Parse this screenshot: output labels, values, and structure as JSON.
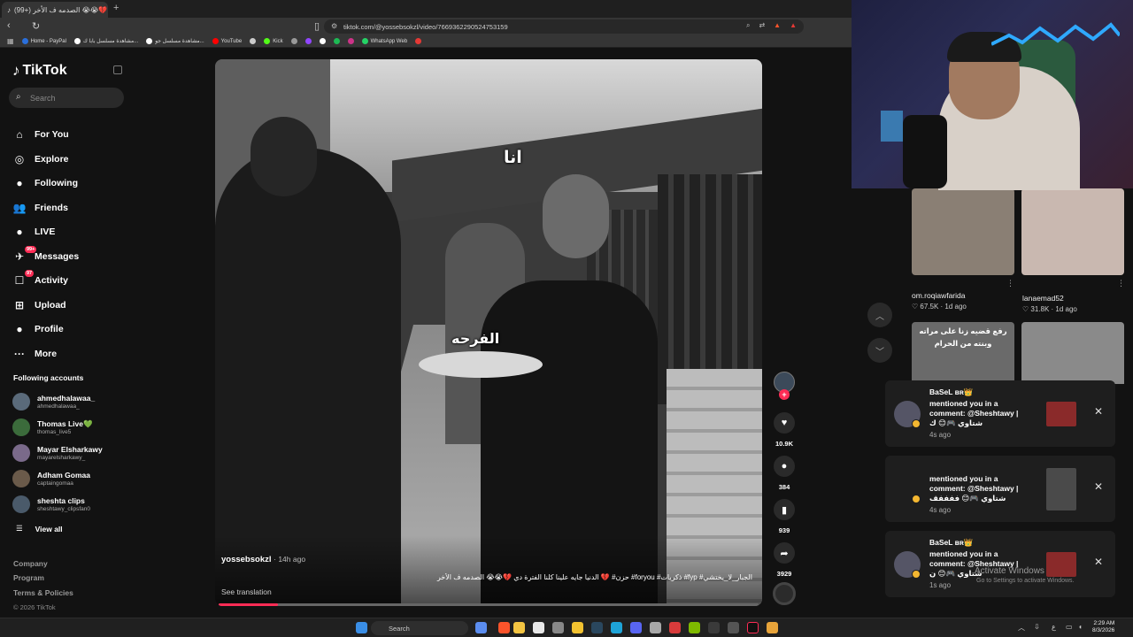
{
  "browser": {
    "tab_title": "(99+) الصدمه ف الأخر 😭😭💔",
    "tab_close": "✕",
    "new_tab": "+",
    "url": "tiktok.com/@yossebsokzl/video/7669362290524753159",
    "bookmarks": [
      {
        "label": "Home - PayPal",
        "color": "#2a6fdb"
      },
      {
        "label": "مشاهدة مسلسل بابا ك...",
        "color": "#ffffff"
      },
      {
        "label": "مشاهدة مسلسل جو...",
        "color": "#ffffff"
      },
      {
        "label": "YouTube",
        "color": "#ff0000"
      },
      {
        "label": "",
        "color": "#cccccc"
      },
      {
        "label": "Kick",
        "color": "#53fc18"
      },
      {
        "label": "",
        "color": "#999999"
      },
      {
        "label": "",
        "color": "#9146ff"
      },
      {
        "label": "",
        "color": "#ffffff"
      },
      {
        "label": "",
        "color": "#1db954"
      },
      {
        "label": "",
        "color": "#cc3388"
      },
      {
        "label": "WhatsApp Web",
        "color": "#25d366"
      },
      {
        "label": "",
        "color": "#e53935"
      }
    ]
  },
  "sidebar": {
    "logo": "TikTok",
    "search_placeholder": "Search",
    "nav": [
      {
        "label": "For You",
        "icon": "home-icon",
        "glyph": "⌂"
      },
      {
        "label": "Explore",
        "icon": "compass-icon",
        "glyph": "◎"
      },
      {
        "label": "Following",
        "icon": "following-icon",
        "glyph": "●"
      },
      {
        "label": "Friends",
        "icon": "friends-icon",
        "glyph": "👥"
      },
      {
        "label": "LIVE",
        "icon": "live-icon",
        "glyph": "●"
      },
      {
        "label": "Messages",
        "icon": "messages-icon",
        "glyph": "✈",
        "badge": "99+"
      },
      {
        "label": "Activity",
        "icon": "activity-icon",
        "glyph": "☐",
        "badge": "97"
      },
      {
        "label": "Upload",
        "icon": "upload-icon",
        "glyph": "⊞"
      },
      {
        "label": "Profile",
        "icon": "profile-icon",
        "glyph": "●"
      },
      {
        "label": "More",
        "icon": "more-icon",
        "glyph": "···"
      }
    ],
    "following_title": "Following accounts",
    "following": [
      {
        "name": "ahmedhalawaa_",
        "handle": "ahmedhalawaa_"
      },
      {
        "name": "Thomas Live💚",
        "handle": "thomas_live5"
      },
      {
        "name": "Mayar Elsharkawy",
        "handle": "mayarelsharkawy_"
      },
      {
        "name": "Adham Gomaa",
        "handle": "captaingomaa"
      },
      {
        "name": "sheshta clips",
        "handle": "sheshtawy_clipsfan0"
      }
    ],
    "view_all": "View all",
    "footer": [
      "Company",
      "Program",
      "Terms & Policies"
    ],
    "copyright": "© 2026 TikTok"
  },
  "video": {
    "caption_top": "انا",
    "caption_mid": "الفرحه",
    "author": "yossebsokzl",
    "ago": "· 14h ago",
    "description": "الجبار_لا_يختشي# fyp# ذكريات# foryou# حزن# 💔 الدنيا جايه علينا كلنا الفترة دي 💔😭😭 الصدمه ف الأخر",
    "see_translation": "See translation",
    "progress": 0.11,
    "likes": "10.9K",
    "comments": "384",
    "saves": "939",
    "shares": "3929"
  },
  "right_panel": {
    "thumbs": [
      {
        "author": "om.roqiawfarida",
        "likes": "♡ 67.5K · 1d ago",
        "color": "#8a7f74"
      },
      {
        "author": "lanaemad52",
        "likes": "♡ 31.8K · 1d ago",
        "color": "#c9b8b0"
      },
      {
        "caption": "رفع قضيه زنا على مراته وبنته من الحرام",
        "color": "#6a6a6a"
      },
      {
        "caption": "",
        "color": "#8a8a8a"
      }
    ]
  },
  "notifications": [
    {
      "name": "BaSeL ʙʀ👑",
      "text": "mentioned you in a comment: @Sheshtawy | شتاوي 🎮😊 ك",
      "time": "4s ago"
    },
    {
      "name": "",
      "text": "mentioned you in a comment: @Sheshtawy | شتاوي 🎮😊 ففففف",
      "time": "4s ago"
    },
    {
      "name": "BaSeL ʙʀ👑",
      "text": "mentioned you in a comment: @Sheshtawy | شتاوي 🎮😊 ن",
      "time": "1s ago"
    }
  ],
  "watermark": {
    "line1": "Activate Windows",
    "line2": "Go to Settings to activate Windows."
  },
  "taskbar": {
    "search_label": "Search",
    "time": "2:29 AM",
    "date": "8/3/2026"
  }
}
